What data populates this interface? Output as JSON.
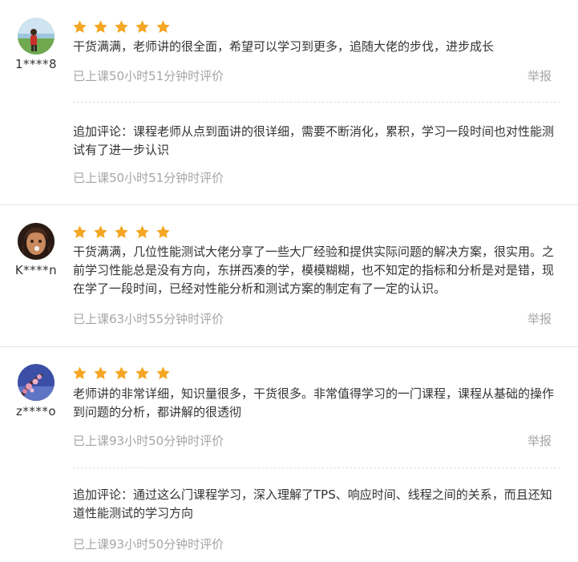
{
  "reviews": [
    {
      "username": "1****8",
      "rating": 5,
      "comment": "干货满满，老师讲的很全面，希望可以学习到更多，追随大佬的步伐，进步成长",
      "time": "已上课50小时51分钟时评价",
      "report_label": "举报",
      "followup": {
        "text": "追加评论：课程老师从点到面讲的很详细，需要不断消化，累积，学习一段时间也对性能测试有了进一步认识",
        "time": "已上课50小时51分钟时评价"
      }
    },
    {
      "username": "K****n",
      "rating": 5,
      "comment": "干货满满，几位性能测试大佬分享了一些大厂经验和提供实际问题的解决方案，很实用。之前学习性能总是没有方向，东拼西凑的学，模模糊糊，也不知定的指标和分析是对是错，现在学了一段时间，已经对性能分析和测试方案的制定有了一定的认识。",
      "time": "已上课63小时55分钟时评价",
      "report_label": "举报"
    },
    {
      "username": "z****o",
      "rating": 5,
      "comment": "老师讲的非常详细，知识量很多，干货很多。非常值得学习的一门课程，课程从基础的操作到问题的分析，都讲解的很透彻",
      "time": "已上课93小时50分钟时评价",
      "report_label": "举报",
      "followup": {
        "text": "追加评论：通过这么门课程学习，深入理解了TPS、响应时间、线程之间的关系，而且还知道性能测试的学习方向",
        "time": "已上课93小时50分钟时评价"
      }
    }
  ],
  "colors": {
    "star": "#f5a623",
    "meta": "#a6a6a6",
    "text": "#333333",
    "divider": "#e6e6e6"
  },
  "icons": [
    "star-icon",
    "avatar-image"
  ]
}
